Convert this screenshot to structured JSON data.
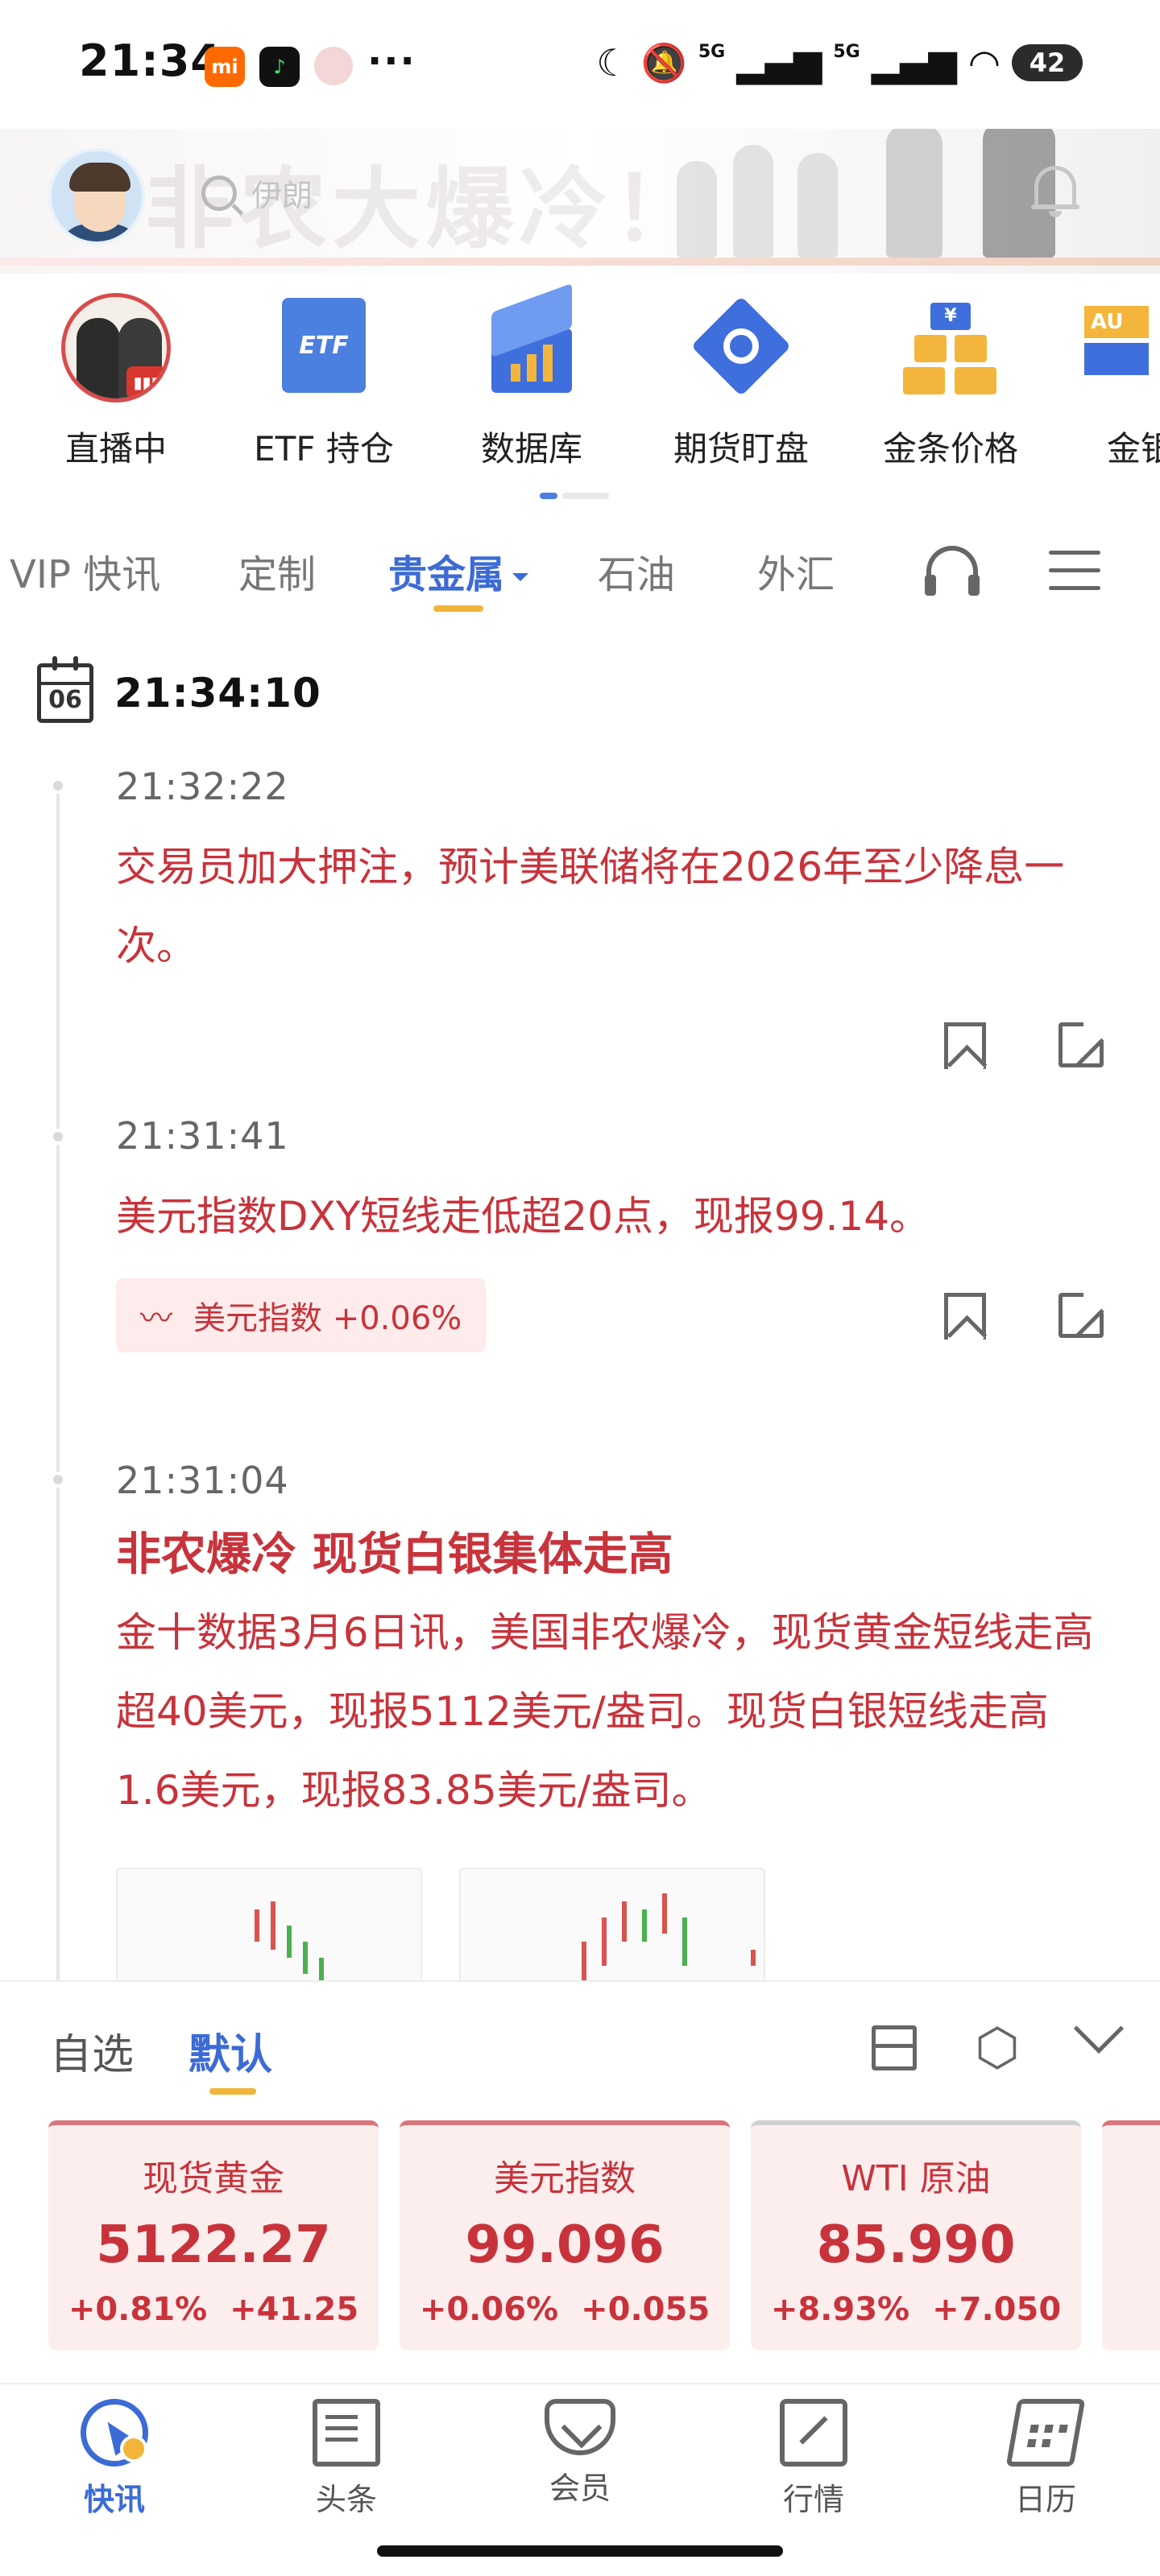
{
  "status_bar": {
    "time": "21:34",
    "app_icons": [
      "mi-app-icon",
      "music-app-icon",
      "avatar-app-icon"
    ],
    "more": "···",
    "network": [
      "5G",
      "5G"
    ],
    "battery": "42"
  },
  "header": {
    "banner_text": "非农大爆冷！",
    "search_placeholder": "伊朗"
  },
  "shortcuts": [
    {
      "label": "直播中",
      "icon": "live-icon"
    },
    {
      "label": "ETF 持仓",
      "icon": "etf-icon",
      "icon_text": "ETF"
    },
    {
      "label": "数据库",
      "icon": "database-icon"
    },
    {
      "label": "期货盯盘",
      "icon": "futures-icon"
    },
    {
      "label": "金条价格",
      "icon": "gold-bar-icon",
      "icon_text": "¥"
    },
    {
      "label": "金银",
      "icon": "au-icon",
      "icon_text": "AU"
    }
  ],
  "tabs": [
    {
      "label": "VIP 快讯",
      "active": false
    },
    {
      "label": "定制",
      "active": false
    },
    {
      "label": "贵金属",
      "active": true
    },
    {
      "label": "石油",
      "active": false
    },
    {
      "label": "外汇",
      "active": false
    }
  ],
  "feed": {
    "calendar_day": "06",
    "current_time": "21:34:10",
    "items": [
      {
        "time": "21:32:22",
        "text": "交易员加大押注，预计美联储将在2026年至少降息一次。"
      },
      {
        "time": "21:31:41",
        "text": "美元指数DXY短线走低超20点，现报99.14。",
        "tag": "美元指数 +0.06%"
      },
      {
        "time": "21:31:04",
        "headline": "非农爆冷 现货白银集体走高",
        "body": "金十数据3月6日讯，美国非农爆冷，现货黄金短线走高超40美元，现报5112美元/盎司。现货白银短线走高1.6美元，现报83.85美元/盎司。"
      }
    ]
  },
  "watchlist": {
    "tabs": [
      {
        "label": "自选",
        "active": false
      },
      {
        "label": "默认",
        "active": true
      }
    ],
    "cards": [
      {
        "name": "现货黄金",
        "price": "5122.27",
        "pct": "+0.81%",
        "chg": "+41.25"
      },
      {
        "name": "美元指数",
        "price": "99.096",
        "pct": "+0.06%",
        "chg": "+0.055"
      },
      {
        "name": "WTI 原油",
        "price": "85.990",
        "pct": "+8.93%",
        "chg": "+7.050"
      }
    ]
  },
  "bottom_nav": [
    {
      "label": "快讯",
      "active": true
    },
    {
      "label": "头条",
      "active": false
    },
    {
      "label": "会员",
      "active": false
    },
    {
      "label": "行情",
      "active": false
    },
    {
      "label": "日历",
      "active": false
    }
  ],
  "colors": {
    "accent_blue": "#3c6bd6",
    "news_red": "#c8333b",
    "underline_gold": "#f2b53a",
    "card_bg": "#fdeeee"
  }
}
